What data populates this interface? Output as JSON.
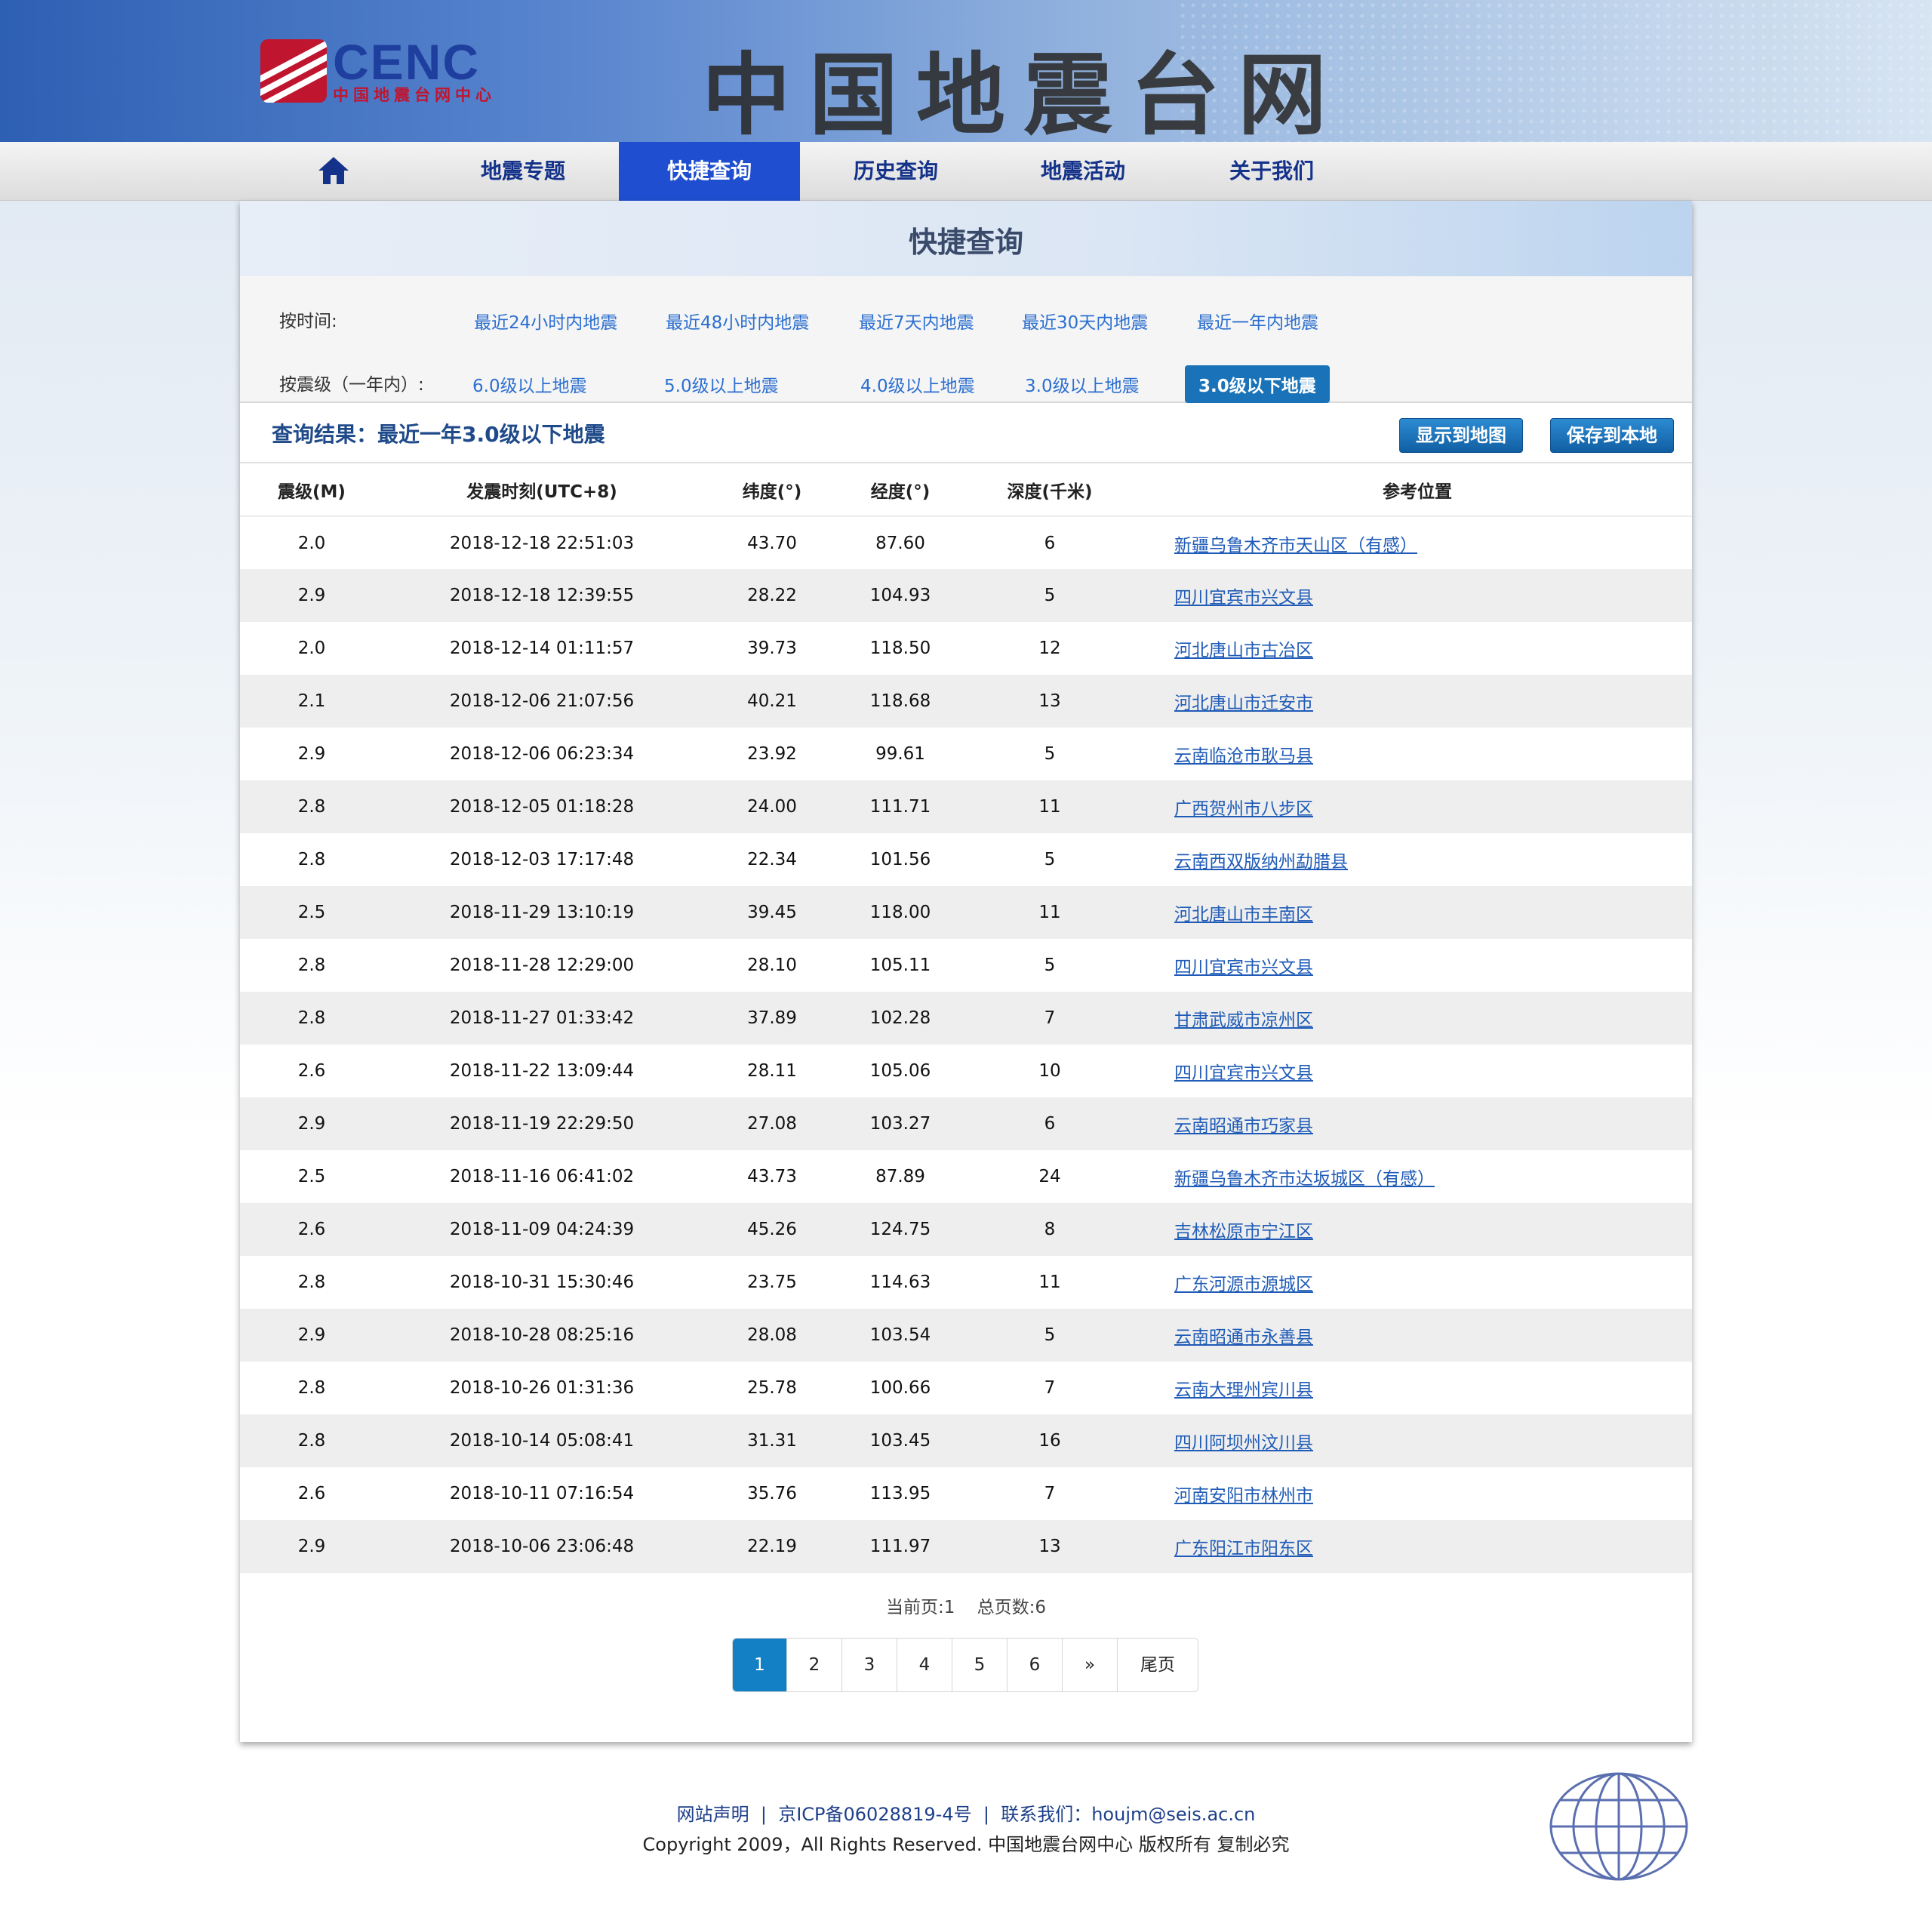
{
  "header": {
    "logo_word": "CENC",
    "logo_sub": "中国地震台网中心",
    "site_title": "中国地震台网"
  },
  "nav": {
    "home_icon": "home-icon",
    "items": [
      {
        "label": "地震专题"
      },
      {
        "label": "快捷查询",
        "active": true
      },
      {
        "label": "历史查询"
      },
      {
        "label": "地震活动"
      },
      {
        "label": "关于我们"
      }
    ]
  },
  "panel": {
    "title": "快捷查询",
    "filters": {
      "time_label": "按时间:",
      "time_links": [
        "最近24小时内地震",
        "最近48小时内地震",
        "最近7天内地震",
        "最近30天内地震",
        "最近一年内地震"
      ],
      "mag_label": "按震级（一年内）:",
      "mag_links": [
        "6.0级以上地震",
        "5.0级以上地震",
        "4.0级以上地震",
        "3.0级以上地震",
        "3.0级以下地震"
      ]
    },
    "result_text": "查询结果：最近一年3.0级以下地震",
    "buttons": {
      "map": "显示到地图",
      "save": "保存到本地"
    }
  },
  "table": {
    "headers": [
      "震级(M)",
      "发震时刻(UTC+8)",
      "纬度(°)",
      "经度(°)",
      "深度(千米)",
      "参考位置"
    ],
    "rows": [
      [
        "2.0",
        "2018-12-18 22:51:03",
        "43.70",
        "87.60",
        "6",
        "新疆乌鲁木齐市天山区（有感）"
      ],
      [
        "2.9",
        "2018-12-18 12:39:55",
        "28.22",
        "104.93",
        "5",
        "四川宜宾市兴文县"
      ],
      [
        "2.0",
        "2018-12-14 01:11:57",
        "39.73",
        "118.50",
        "12",
        "河北唐山市古冶区"
      ],
      [
        "2.1",
        "2018-12-06 21:07:56",
        "40.21",
        "118.68",
        "13",
        "河北唐山市迁安市"
      ],
      [
        "2.9",
        "2018-12-06 06:23:34",
        "23.92",
        "99.61",
        "5",
        "云南临沧市耿马县"
      ],
      [
        "2.8",
        "2018-12-05 01:18:28",
        "24.00",
        "111.71",
        "11",
        "广西贺州市八步区"
      ],
      [
        "2.8",
        "2018-12-03 17:17:48",
        "22.34",
        "101.56",
        "5",
        "云南西双版纳州勐腊县"
      ],
      [
        "2.5",
        "2018-11-29 13:10:19",
        "39.45",
        "118.00",
        "11",
        "河北唐山市丰南区"
      ],
      [
        "2.8",
        "2018-11-28 12:29:00",
        "28.10",
        "105.11",
        "5",
        "四川宜宾市兴文县"
      ],
      [
        "2.8",
        "2018-11-27 01:33:42",
        "37.89",
        "102.28",
        "7",
        "甘肃武威市凉州区"
      ],
      [
        "2.6",
        "2018-11-22 13:09:44",
        "28.11",
        "105.06",
        "10",
        "四川宜宾市兴文县"
      ],
      [
        "2.9",
        "2018-11-19 22:29:50",
        "27.08",
        "103.27",
        "6",
        "云南昭通市巧家县"
      ],
      [
        "2.5",
        "2018-11-16 06:41:02",
        "43.73",
        "87.89",
        "24",
        "新疆乌鲁木齐市达坂城区（有感）"
      ],
      [
        "2.6",
        "2018-11-09 04:24:39",
        "45.26",
        "124.75",
        "8",
        "吉林松原市宁江区"
      ],
      [
        "2.8",
        "2018-10-31 15:30:46",
        "23.75",
        "114.63",
        "11",
        "广东河源市源城区"
      ],
      [
        "2.9",
        "2018-10-28 08:25:16",
        "28.08",
        "103.54",
        "5",
        "云南昭通市永善县"
      ],
      [
        "2.8",
        "2018-10-26 01:31:36",
        "25.78",
        "100.66",
        "7",
        "云南大理州宾川县"
      ],
      [
        "2.8",
        "2018-10-14 05:08:41",
        "31.31",
        "103.45",
        "16",
        "四川阿坝州汶川县"
      ],
      [
        "2.6",
        "2018-10-11 07:16:54",
        "35.76",
        "113.95",
        "7",
        "河南安阳市林州市"
      ],
      [
        "2.9",
        "2018-10-06 23:06:48",
        "22.19",
        "111.97",
        "13",
        "广东阳江市阳东区"
      ]
    ]
  },
  "pagination": {
    "current_label": "当前页:1",
    "total_label": "总页数:6",
    "pages": [
      "1",
      "2",
      "3",
      "4",
      "5",
      "6",
      "»",
      "尾页"
    ],
    "current": "1"
  },
  "footer": {
    "statement": "网站声明",
    "icp": "京ICP备06028819-4号",
    "contact": "联系我们：houjm@seis.ac.cn",
    "copyright": "Copyright 2009，All Rights Reserved. 中国地震台网中心 版权所有 复制必究"
  },
  "colors": {
    "accent": "#1f4fd0",
    "link": "#1f5bb7",
    "button": "#1a73b8",
    "title_text": "#3a4a6a"
  }
}
